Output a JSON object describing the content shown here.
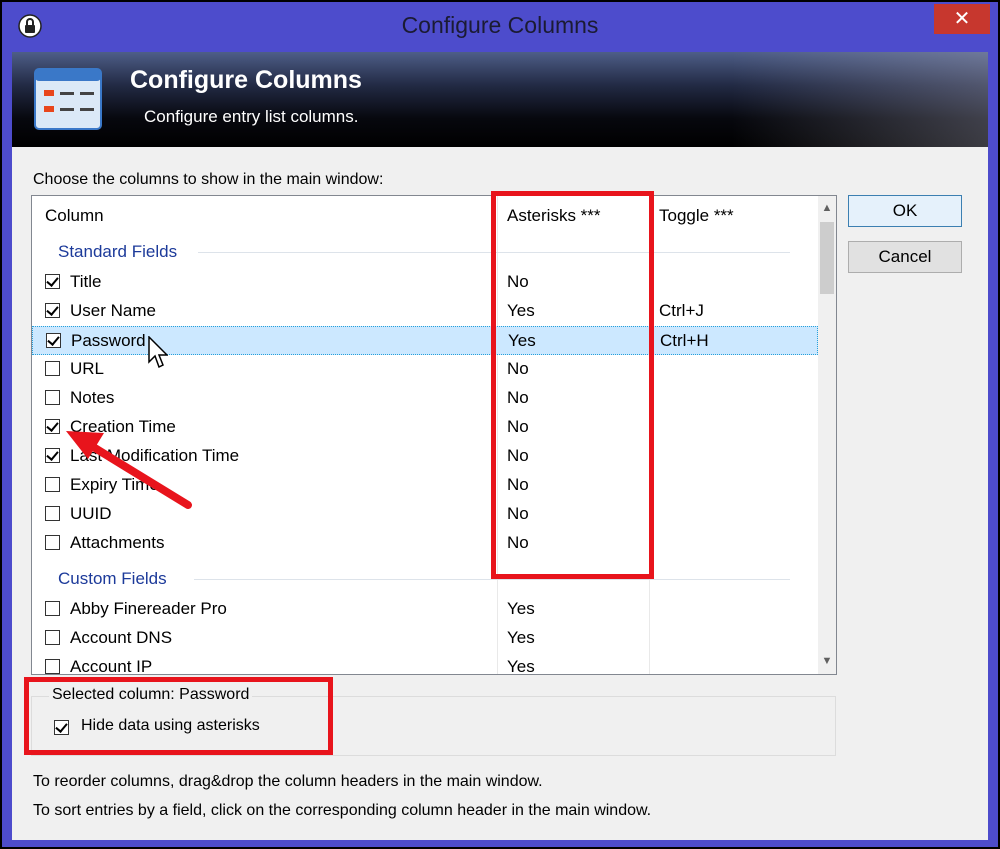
{
  "window": {
    "title": "Configure Columns",
    "close_glyph": "✕"
  },
  "banner": {
    "title": "Configure Columns",
    "subtitle": "Configure entry list columns."
  },
  "instruction": "Choose the columns to show in the main window:",
  "list": {
    "headers": {
      "column": "Column",
      "asterisks": "Asterisks ***",
      "toggle": "Toggle ***"
    },
    "groups": {
      "standard": "Standard Fields",
      "custom": "Custom Fields"
    },
    "standard_rows": [
      {
        "name": "Title",
        "checked": true,
        "asterisks": "No",
        "toggle": ""
      },
      {
        "name": "User Name",
        "checked": true,
        "asterisks": "Yes",
        "toggle": "Ctrl+J"
      },
      {
        "name": "Password",
        "checked": true,
        "asterisks": "Yes",
        "toggle": "Ctrl+H",
        "selected": true
      },
      {
        "name": "URL",
        "checked": false,
        "asterisks": "No",
        "toggle": ""
      },
      {
        "name": "Notes",
        "checked": false,
        "asterisks": "No",
        "toggle": ""
      },
      {
        "name": "Creation Time",
        "checked": true,
        "asterisks": "No",
        "toggle": ""
      },
      {
        "name": "Last Modification Time",
        "checked": true,
        "asterisks": "No",
        "toggle": ""
      },
      {
        "name": "Expiry Time",
        "checked": false,
        "asterisks": "No",
        "toggle": ""
      },
      {
        "name": "UUID",
        "checked": false,
        "asterisks": "No",
        "toggle": ""
      },
      {
        "name": "Attachments",
        "checked": false,
        "asterisks": "No",
        "toggle": ""
      }
    ],
    "custom_rows": [
      {
        "name": "Abby Finereader Pro",
        "checked": false,
        "asterisks": "Yes",
        "toggle": ""
      },
      {
        "name": "Account DNS",
        "checked": false,
        "asterisks": "Yes",
        "toggle": ""
      },
      {
        "name": "Account IP",
        "checked": false,
        "asterisks": "Yes",
        "toggle": ""
      }
    ]
  },
  "buttons": {
    "ok": "OK",
    "cancel": "Cancel"
  },
  "selected_column": {
    "label": "Selected column: Password",
    "hide_label": "Hide data using asterisks",
    "hide_checked": true
  },
  "notes": {
    "reorder": "To reorder columns, drag&drop the column headers in the main window.",
    "sort": "To sort entries by a field, click on the corresponding column header in the main window."
  },
  "colors": {
    "annotation_red": "#e8141c",
    "window_frame": "#4d4ccc",
    "group_blue": "#1c3a9a",
    "selection": "#cce8ff"
  },
  "icons": [
    "lock-icon",
    "close-icon",
    "columns-icon",
    "checkbox-icon",
    "mouse-cursor-icon",
    "scroll-up-icon",
    "scroll-down-icon"
  ]
}
